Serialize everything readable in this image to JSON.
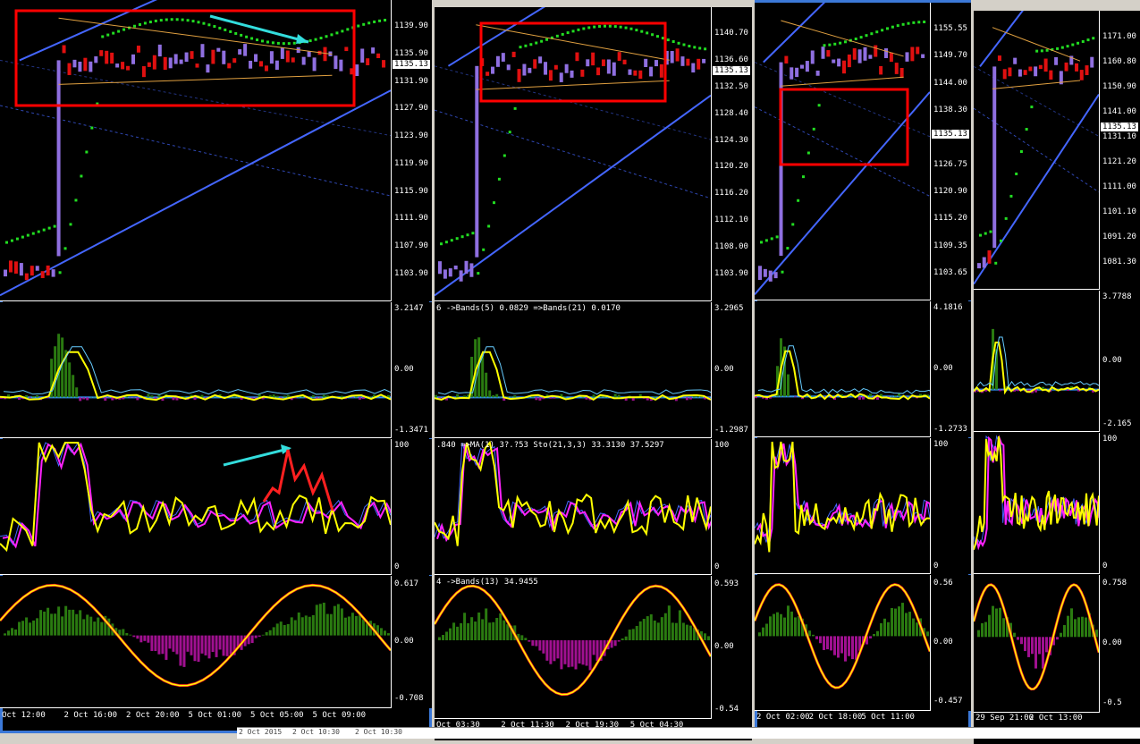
{
  "windows": [
    {
      "id": "w1",
      "price_axis": [
        "1139.90",
        "1135.90",
        "1131.90",
        "1127.90",
        "1123.90",
        "1119.90",
        "1115.90",
        "1111.90",
        "1107.90",
        "1103.90"
      ],
      "current_price": "1135.13",
      "bands_axis": [
        "3.2147",
        "0.00",
        "-1.3471"
      ],
      "sto_axis": [
        "100",
        "0"
      ],
      "osc_axis": [
        "0.617",
        "0.00",
        "-0.708"
      ],
      "band_label": "",
      "sto_label": "",
      "osc_label": "",
      "time_axis": [
        "Oct 12:00",
        "2 Oct 16:00",
        "2 Oct 20:00",
        "5 Oct 01:00",
        "5 Oct 05:00",
        "5 Oct 09:00"
      ]
    },
    {
      "id": "w2",
      "price_axis": [
        "1140.70",
        "1136.60",
        "1132.50",
        "1128.40",
        "1124.30",
        "1120.20",
        "1116.20",
        "1112.10",
        "1108.00",
        "1103.90"
      ],
      "current_price": "1135.13",
      "bands_axis": [
        "3.2965",
        "0.00",
        "-1.2987"
      ],
      "sto_axis": [
        "100",
        "0"
      ],
      "osc_axis": [
        "0.593",
        "0.00",
        "-0.54"
      ],
      "band_label": "6  ->Bands(5) 0.0829  =>Bands(21) 0.0170",
      "sto_label": ".840  =>MA(1) 3?.?53  Sto(21,3,3) 33.3130 37.5297",
      "osc_label": "4  ->Bands(13) 34.9455",
      "time_axis": [
        "Oct 03:30",
        "2 Oct 11:30",
        "2 Oct 19:30",
        "5 Oct 04:30"
      ]
    },
    {
      "id": "w3",
      "price_axis": [
        "1155.55",
        "1149.70",
        "1144.00",
        "1138.30",
        "1132.45",
        "1126.75",
        "1120.90",
        "1115.20",
        "1109.35",
        "1103.65"
      ],
      "current_price": "1135.13",
      "bands_axis": [
        "4.1816",
        "0.00",
        "-1.2733"
      ],
      "sto_axis": [
        "100",
        "0"
      ],
      "osc_axis": [
        "0.56",
        "0.00",
        "-0.457"
      ],
      "band_label": "",
      "sto_label": "",
      "osc_label": "",
      "time_axis": [
        "2 Oct 02:00",
        "2 Oct 18:00",
        "5 Oct 11:00"
      ]
    },
    {
      "id": "w4",
      "price_axis": [
        "1171.00",
        "1160.80",
        "1150.90",
        "1141.00",
        "1131.10",
        "1121.20",
        "1111.00",
        "1101.10",
        "1091.20",
        "1081.30"
      ],
      "current_price": "1135.13",
      "bands_axis": [
        "3.7788",
        "0.00",
        "-2.165"
      ],
      "sto_axis": [
        "100",
        "0"
      ],
      "osc_axis": [
        "0.758",
        "0.00",
        "-0.5"
      ],
      "band_label": "",
      "sto_label": "",
      "osc_label": "",
      "time_axis": [
        "29 Sep 21:00",
        "2 Oct 13:00"
      ]
    }
  ],
  "bottom_bar": [
    "2 Oct 2015",
    "2 Oct 10:30",
    "2 Oct 10:30"
  ],
  "colors": {
    "bull_candle": "#8f6fe0",
    "bear_candle": "#e01010",
    "sar": "#22dd22",
    "trend": "#4466ff",
    "highlight_box": "#ff0000",
    "arrow": "#33dddd",
    "sto_main": "#ffff00",
    "sto_signal": "#ff22ff",
    "hist_pos": "#2a7a10",
    "hist_neg": "#a01090"
  }
}
